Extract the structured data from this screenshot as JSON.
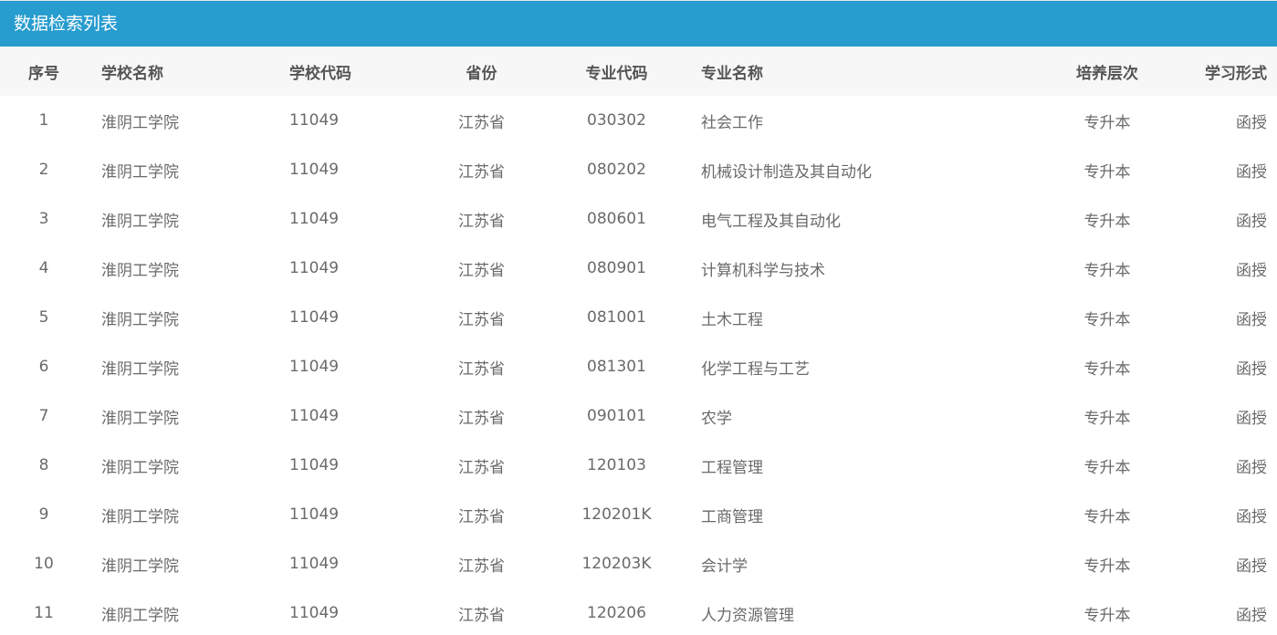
{
  "header": {
    "title": "数据检索列表"
  },
  "table": {
    "columns": [
      "序号",
      "学校名称",
      "学校代码",
      "省份",
      "专业代码",
      "专业名称",
      "培养层次",
      "学习形式"
    ],
    "rows": [
      [
        "1",
        "淮阴工学院",
        "11049",
        "江苏省",
        "030302",
        "社会工作",
        "专升本",
        "函授"
      ],
      [
        "2",
        "淮阴工学院",
        "11049",
        "江苏省",
        "080202",
        "机械设计制造及其自动化",
        "专升本",
        "函授"
      ],
      [
        "3",
        "淮阴工学院",
        "11049",
        "江苏省",
        "080601",
        "电气工程及其自动化",
        "专升本",
        "函授"
      ],
      [
        "4",
        "淮阴工学院",
        "11049",
        "江苏省",
        "080901",
        "计算机科学与技术",
        "专升本",
        "函授"
      ],
      [
        "5",
        "淮阴工学院",
        "11049",
        "江苏省",
        "081001",
        "土木工程",
        "专升本",
        "函授"
      ],
      [
        "6",
        "淮阴工学院",
        "11049",
        "江苏省",
        "081301",
        "化学工程与工艺",
        "专升本",
        "函授"
      ],
      [
        "7",
        "淮阴工学院",
        "11049",
        "江苏省",
        "090101",
        "农学",
        "专升本",
        "函授"
      ],
      [
        "8",
        "淮阴工学院",
        "11049",
        "江苏省",
        "120103",
        "工程管理",
        "专升本",
        "函授"
      ],
      [
        "9",
        "淮阴工学院",
        "11049",
        "江苏省",
        "120201K",
        "工商管理",
        "专升本",
        "函授"
      ],
      [
        "10",
        "淮阴工学院",
        "11049",
        "江苏省",
        "120203K",
        "会计学",
        "专升本",
        "函授"
      ],
      [
        "11",
        "淮阴工学院",
        "11049",
        "江苏省",
        "120206",
        "人力资源管理",
        "专升本",
        "函授"
      ]
    ]
  },
  "colors": {
    "header_bg": "#279cce",
    "thead_bg": "#f7f7f7"
  }
}
